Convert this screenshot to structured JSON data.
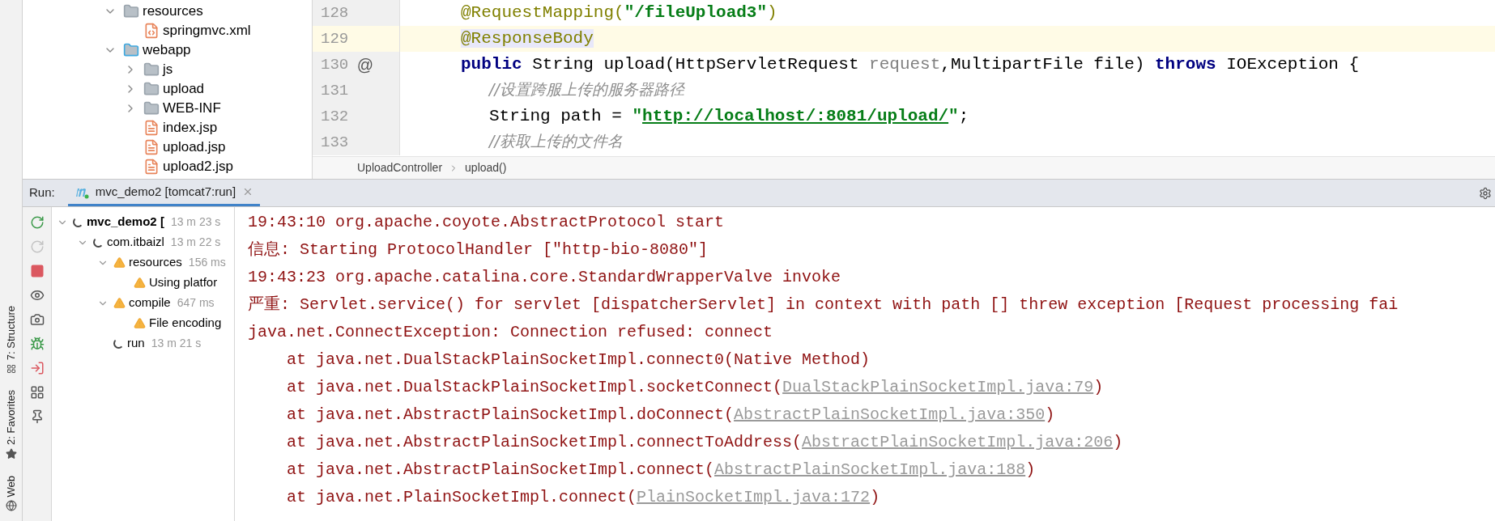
{
  "side_tabs": [
    {
      "kind": "web",
      "label": "Web"
    },
    {
      "kind": "favorites",
      "label": "2: Favorites"
    },
    {
      "kind": "structure",
      "label": "7: Structure"
    }
  ],
  "project_tree": [
    {
      "kind": "resources",
      "label": "resources",
      "expanded": true,
      "children": [
        {
          "kind": "xml",
          "label": "springmvc.xml"
        }
      ]
    },
    {
      "kind": "web",
      "label": "webapp",
      "expanded": true,
      "children": [
        {
          "kind": "folder",
          "label": "js",
          "expanded": false
        },
        {
          "kind": "folder",
          "label": "upload",
          "expanded": false
        },
        {
          "kind": "folder",
          "label": "WEB-INF",
          "expanded": false
        },
        {
          "kind": "jsp",
          "label": "index.jsp"
        },
        {
          "kind": "jsp",
          "label": "upload.jsp"
        },
        {
          "kind": "jsp",
          "label": "upload2.jsp"
        }
      ]
    }
  ],
  "editor": {
    "lines": [
      {
        "number": "128",
        "kind": "member",
        "current": false,
        "tokens": [
          {
            "kind": "annotation",
            "text": "@RequestMapping("
          },
          {
            "kind": "string",
            "text": "\"/fileUpload3\""
          },
          {
            "kind": "annotation",
            "text": ")"
          }
        ]
      },
      {
        "number": "129",
        "kind": "member",
        "current": true,
        "tokens": [
          {
            "kind": "annotation_marked",
            "text": "@ResponseBody"
          }
        ]
      },
      {
        "number": "130",
        "kind": "member",
        "current": false,
        "marker": "@",
        "tokens": [
          {
            "kind": "keyword",
            "text": "public"
          },
          {
            "kind": "plain",
            "text": " String upload(HttpServletRequest "
          },
          {
            "kind": "param",
            "text": "request"
          },
          {
            "kind": "plain",
            "text": ",MultipartFile file) "
          },
          {
            "kind": "keyword",
            "text": "throws"
          },
          {
            "kind": "plain",
            "text": " IOException {"
          }
        ]
      },
      {
        "number": "131",
        "kind": "body",
        "current": false,
        "tokens": [
          {
            "kind": "comment",
            "text": "//设置跨服上传的服务器路径"
          }
        ]
      },
      {
        "number": "132",
        "kind": "body",
        "current": false,
        "tokens": [
          {
            "kind": "plain",
            "text": "String path = "
          },
          {
            "kind": "string",
            "text": "\""
          },
          {
            "kind": "url",
            "text": "http://localhost/:8081/upload/"
          },
          {
            "kind": "string",
            "text": "\""
          },
          {
            "kind": "plain",
            "text": ";"
          }
        ]
      },
      {
        "number": "133",
        "kind": "body",
        "current": false,
        "tokens": [
          {
            "kind": "comment",
            "text": "//获取上传的文件名"
          }
        ]
      }
    ],
    "breadcrumb": [
      "UploadController",
      "upload()"
    ]
  },
  "run": {
    "label": "Run:",
    "tabs": [
      {
        "label": "mvc_demo2 [tomcat7:run]",
        "selected": true
      }
    ],
    "tools": [
      {
        "kind": "rerun",
        "disabled": false
      },
      {
        "kind": "rerun-failed",
        "disabled": true
      },
      {
        "kind": "stop",
        "disabled": false
      },
      {
        "kind": "eye",
        "disabled": false
      },
      {
        "kind": "camera",
        "disabled": false
      },
      {
        "kind": "debug",
        "disabled": false
      },
      {
        "kind": "import",
        "disabled": false
      },
      {
        "kind": "layout",
        "disabled": false
      },
      {
        "kind": "pin",
        "disabled": false
      }
    ],
    "tree": [
      {
        "kind": "running",
        "label": "mvc_demo2 [",
        "time": "13 m 23 s",
        "expanded": true,
        "children": [
          {
            "kind": "running",
            "label": "com.itbaizl",
            "time": "13 m 22 s",
            "expanded": true,
            "children": [
              {
                "kind": "warning",
                "label": "resources",
                "time": "156 ms",
                "expanded": true,
                "children": [
                  {
                    "kind": "warning",
                    "label": "Using platfor"
                  }
                ]
              },
              {
                "kind": "warning",
                "label": "compile",
                "time": "647 ms",
                "expanded": true,
                "children": [
                  {
                    "kind": "warning",
                    "label": "File encoding"
                  }
                ]
              },
              {
                "kind": "running",
                "label": "run",
                "time": "13 m 21 s"
              }
            ]
          }
        ]
      }
    ],
    "console": [
      {
        "kind": "message",
        "parts": [
          {
            "kind": "text",
            "text": "19:43:10 org.apache.coyote.AbstractProtocol start"
          }
        ]
      },
      {
        "kind": "message",
        "parts": [
          {
            "kind": "text",
            "text": "信息: Starting ProtocolHandler [\"http-bio-8080\"]"
          }
        ]
      },
      {
        "kind": "message",
        "parts": [
          {
            "kind": "text",
            "text": "19:43:23 org.apache.catalina.core.StandardWrapperValve invoke"
          }
        ]
      },
      {
        "kind": "message",
        "parts": [
          {
            "kind": "text",
            "text": "严重: Servlet.service() for servlet [dispatcherServlet] in context with path [] threw exception [Request processing fai"
          }
        ]
      },
      {
        "kind": "message",
        "parts": [
          {
            "kind": "text",
            "text": "java.net.ConnectException: Connection refused: connect"
          }
        ]
      },
      {
        "kind": "frame",
        "parts": [
          {
            "kind": "text",
            "text": "at java.net.DualStackPlainSocketImpl.connect0(Native Method)"
          }
        ]
      },
      {
        "kind": "frame",
        "parts": [
          {
            "kind": "text",
            "text": "at java.net.DualStackPlainSocketImpl.socketConnect("
          },
          {
            "kind": "link",
            "text": "DualStackPlainSocketImpl.java:79"
          },
          {
            "kind": "text",
            "text": ")"
          }
        ]
      },
      {
        "kind": "frame",
        "parts": [
          {
            "kind": "text",
            "text": "at java.net.AbstractPlainSocketImpl.doConnect("
          },
          {
            "kind": "link",
            "text": "AbstractPlainSocketImpl.java:350"
          },
          {
            "kind": "text",
            "text": ")"
          }
        ]
      },
      {
        "kind": "frame",
        "parts": [
          {
            "kind": "text",
            "text": "at java.net.AbstractPlainSocketImpl.connectToAddress("
          },
          {
            "kind": "link",
            "text": "AbstractPlainSocketImpl.java:206"
          },
          {
            "kind": "text",
            "text": ")"
          }
        ]
      },
      {
        "kind": "frame",
        "parts": [
          {
            "kind": "text",
            "text": "at java.net.AbstractPlainSocketImpl.connect("
          },
          {
            "kind": "link",
            "text": "AbstractPlainSocketImpl.java:188"
          },
          {
            "kind": "text",
            "text": ")"
          }
        ]
      },
      {
        "kind": "frame",
        "parts": [
          {
            "kind": "text",
            "text": "at java.net.PlainSocketImpl.connect("
          },
          {
            "kind": "link",
            "text": "PlainSocketImpl.java:172"
          },
          {
            "kind": "text",
            "text": ")"
          }
        ]
      }
    ]
  }
}
